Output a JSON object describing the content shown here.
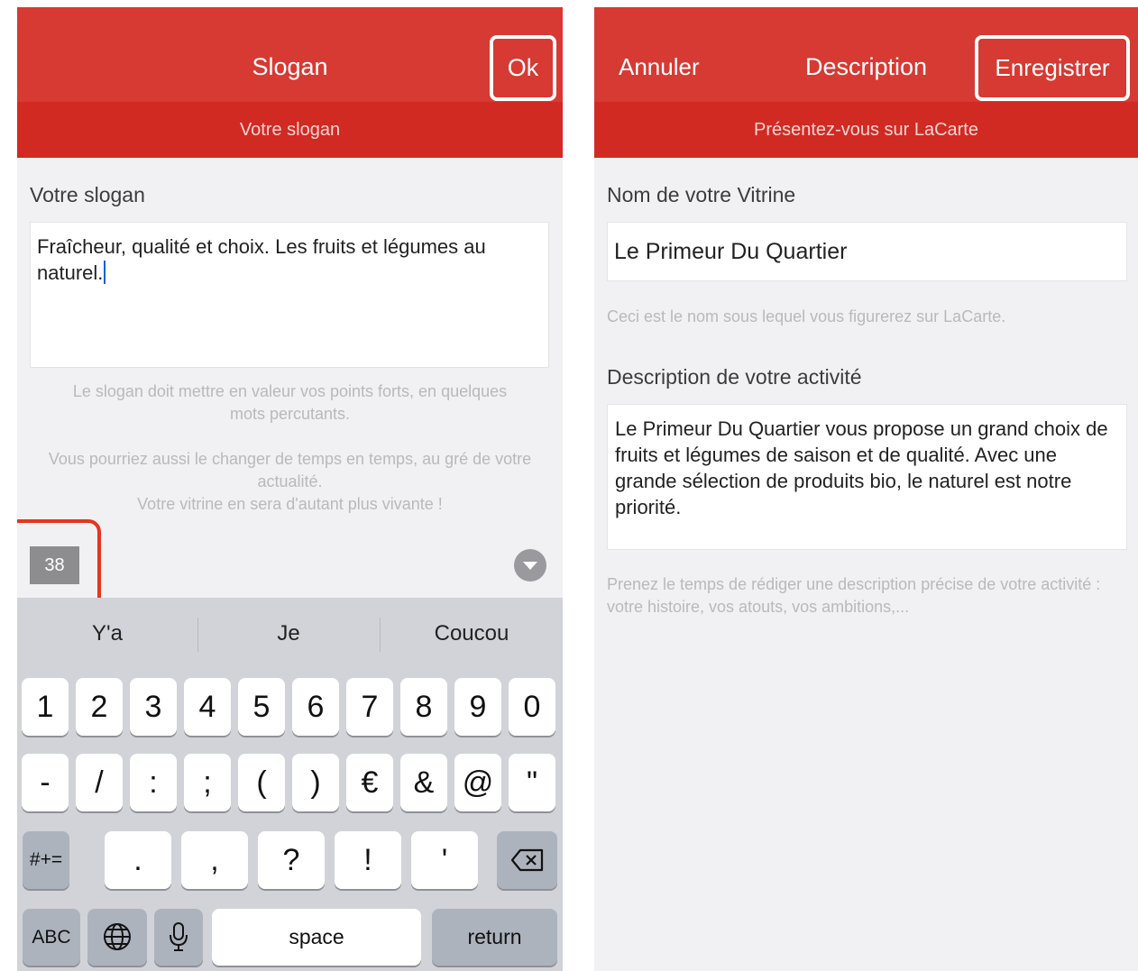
{
  "left_screen": {
    "nav_title": "Slogan",
    "ok_label": "Ok",
    "subtitle": "Votre slogan",
    "field_label": "Votre slogan",
    "field_value": "Fraîcheur, qualité et choix. Les fruits et légumes au naturel.",
    "help_1": "Le slogan doit mettre en valeur vos points forts, en quelques mots percutants.",
    "help_2": "Vous pourriez aussi le changer de temps en temps, au gré de votre actualité.",
    "help_3": "Votre vitrine en sera d'autant plus vivante !",
    "char_counter": "38",
    "highlight_color": "#e5351c",
    "dismiss_icon": "chevron-down-circle-icon",
    "keyboard": {
      "suggestions": [
        "Y'a",
        "Je",
        "Coucou"
      ],
      "row1": [
        "1",
        "2",
        "3",
        "4",
        "5",
        "6",
        "7",
        "8",
        "9",
        "0"
      ],
      "row2": [
        "-",
        "/",
        ":",
        ";",
        "(",
        ")",
        "€",
        "&",
        "@",
        "\""
      ],
      "row3_mode": "#+=",
      "row3": [
        ".",
        ",",
        "?",
        "!",
        "'"
      ],
      "backspace_icon": "backspace-icon",
      "abc": "ABC",
      "globe_icon": "globe-icon",
      "mic_icon": "microphone-icon",
      "space": "space",
      "return": "return"
    }
  },
  "right_screen": {
    "cancel_label": "Annuler",
    "nav_title": "Description",
    "save_label": "Enregistrer",
    "subtitle": "Présentez-vous sur LaCarte",
    "name_label": "Nom de votre Vitrine",
    "name_value": "Le Primeur Du Quartier",
    "name_help": "Ceci est le nom sous lequel vous figurerez sur LaCarte.",
    "desc_label": "Description de votre activité",
    "desc_value": "Le Primeur Du Quartier vous propose un grand choix de fruits et légumes de saison et de qualité. Avec une grande sélection de produits bio, le naturel est notre priorité.",
    "desc_help": "Prenez le temps de rédiger une description précise de votre activité : votre histoire, vos atouts, vos ambitions,..."
  },
  "colors": {
    "brand_red": "#d63a33",
    "subbar_red": "#d12a22"
  }
}
